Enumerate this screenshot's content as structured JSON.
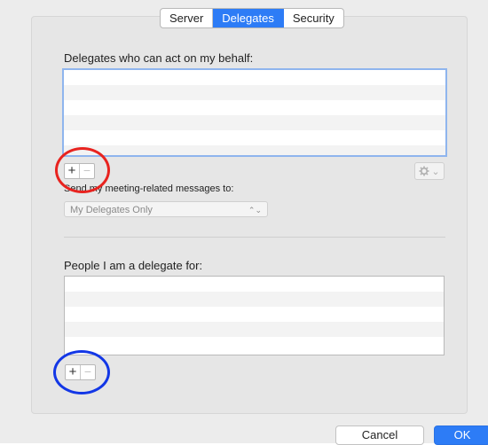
{
  "tabs": [
    {
      "label": "Server",
      "active": false
    },
    {
      "label": "Delegates",
      "active": true
    },
    {
      "label": "Security",
      "active": false
    }
  ],
  "delegates_section": {
    "label": "Delegates who can act on my behalf:",
    "add_symbol": "+",
    "remove_symbol": "−",
    "gear_icon": "gear-icon",
    "gear_caret": "⌄"
  },
  "send_to": {
    "label": "Send my meeting-related messages to:",
    "selected": "My Delegates Only",
    "arrows": "⌃⌄"
  },
  "delegate_for_section": {
    "label": "People I am a delegate for:",
    "add_symbol": "+",
    "remove_symbol": "−"
  },
  "footer": {
    "cancel_label": "Cancel",
    "ok_label": "OK"
  },
  "colors": {
    "accent": "#2d7cf6",
    "annotation_red": "#e8231f",
    "annotation_blue": "#1337e6"
  }
}
